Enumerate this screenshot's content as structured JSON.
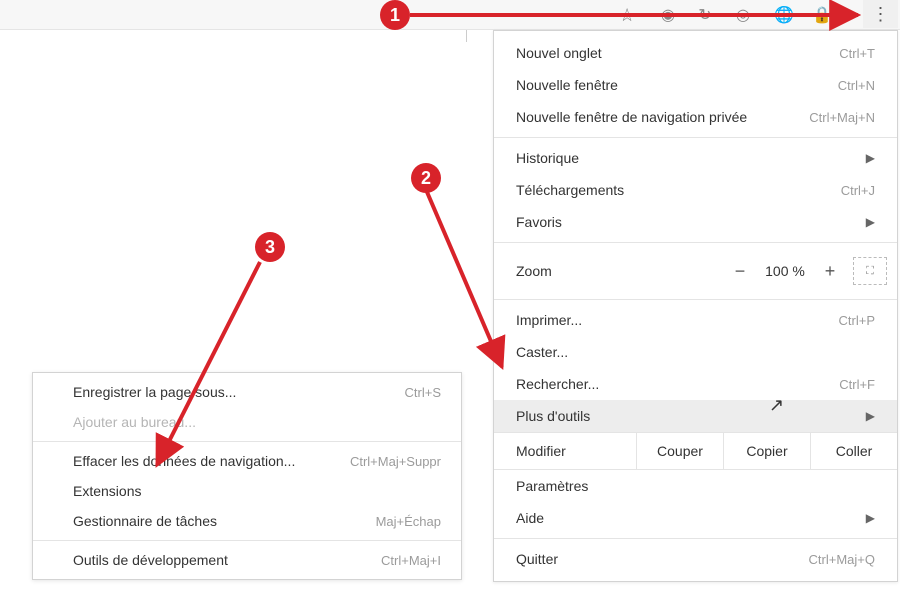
{
  "badges": {
    "one": "1",
    "two": "2",
    "three": "3"
  },
  "toolbar": {
    "menu_dots": "⋮"
  },
  "main_menu": {
    "new_tab": {
      "label": "Nouvel onglet",
      "shortcut": "Ctrl+T"
    },
    "new_window": {
      "label": "Nouvelle fenêtre",
      "shortcut": "Ctrl+N"
    },
    "incognito": {
      "label": "Nouvelle fenêtre de navigation privée",
      "shortcut": "Ctrl+Maj+N"
    },
    "history": {
      "label": "Historique"
    },
    "downloads": {
      "label": "Téléchargements",
      "shortcut": "Ctrl+J"
    },
    "bookmarks": {
      "label": "Favoris"
    },
    "zoom": {
      "label": "Zoom",
      "minus": "−",
      "value": "100 %",
      "plus": "+"
    },
    "print": {
      "label": "Imprimer...",
      "shortcut": "Ctrl+P"
    },
    "cast": {
      "label": "Caster..."
    },
    "find": {
      "label": "Rechercher...",
      "shortcut": "Ctrl+F"
    },
    "more_tools": {
      "label": "Plus d'outils"
    },
    "edit": {
      "label": "Modifier",
      "cut": "Couper",
      "copy": "Copier",
      "paste": "Coller"
    },
    "settings": {
      "label": "Paramètres"
    },
    "help": {
      "label": "Aide"
    },
    "quit": {
      "label": "Quitter",
      "shortcut": "Ctrl+Maj+Q"
    }
  },
  "sub_menu": {
    "save_as": {
      "label": "Enregistrer la page sous...",
      "shortcut": "Ctrl+S"
    },
    "add_desktop": {
      "label": "Ajouter au bureau..."
    },
    "clear_data": {
      "label": "Effacer les données de navigation...",
      "shortcut": "Ctrl+Maj+Suppr"
    },
    "extensions": {
      "label": "Extensions"
    },
    "task_mgr": {
      "label": "Gestionnaire de tâches",
      "shortcut": "Maj+Échap"
    },
    "dev_tools": {
      "label": "Outils de développement",
      "shortcut": "Ctrl+Maj+I"
    }
  }
}
